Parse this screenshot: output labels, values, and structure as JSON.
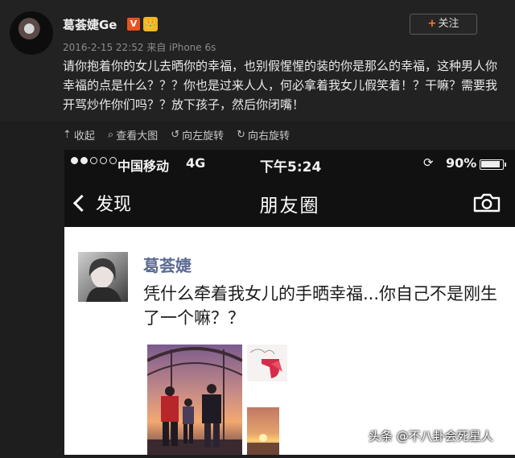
{
  "post": {
    "username": "葛荟婕Ge",
    "verified_badge": "V",
    "crown_badge": "👑",
    "follow_label": "关注",
    "timestamp": "2016-2-15 22:52",
    "source": "来自 iPhone 6s",
    "text": "请你抱着你的女儿去晒你的幸福，也别假惺惺的装的你是那么的幸福，这种男人你幸福的点是什么？？？你也是过来人人，何必拿着我女儿假笑着！？干嘛？需要我开骂炒作你们吗？？放下孩子，然后你闭嘴！"
  },
  "actions": [
    {
      "icon": "collapse-icon",
      "glyph": "⇡",
      "label": "收起"
    },
    {
      "icon": "magnify-icon",
      "glyph": "⌕",
      "label": "查看大图"
    },
    {
      "icon": "rotate-left-icon",
      "glyph": "↺",
      "label": "向左旋转"
    },
    {
      "icon": "rotate-right-icon",
      "glyph": "↻",
      "label": "向右旋转"
    }
  ],
  "statusbar": {
    "carrier": "中国移动",
    "network": "4G",
    "time": "下午5:24",
    "battery_percent_label": "90%",
    "battery_level": 0.9,
    "signal_bars_filled": 2,
    "signal_bars_total": 5
  },
  "navbar": {
    "back_label": "发现",
    "title": "朋友圈"
  },
  "moment": {
    "name": "葛荟婕",
    "text": "凭什么牵着我女儿的手晒幸福...你自己不是刚生了一个嘛？？"
  },
  "watermark": "头条 @不八卦会死星人",
  "colors": {
    "follow_plus": "#ff7a2f",
    "vbadge": "#e8531f",
    "moment_name": "#5b6b92"
  }
}
